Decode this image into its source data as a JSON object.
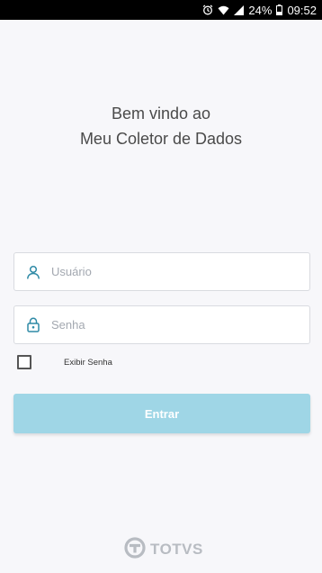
{
  "status_bar": {
    "battery": "24%",
    "time": "09:52",
    "icons": [
      "alarm-icon",
      "wifi-icon",
      "signal-icon",
      "battery-icon"
    ]
  },
  "welcome": {
    "line1": "Bem vindo ao",
    "line2": "Meu Coletor de Dados"
  },
  "login": {
    "username_placeholder": "Usuário",
    "username_value": "",
    "password_placeholder": "Senha",
    "password_value": "",
    "show_password_label": "Exibir Senha",
    "show_password_checked": false,
    "submit_label": "Entrar"
  },
  "brand": {
    "logo_text": "TOTVS"
  },
  "colors": {
    "accent_icon": "#2f8aa6",
    "button_bg": "#9fd6e6",
    "logo": "#b8bcc2"
  }
}
